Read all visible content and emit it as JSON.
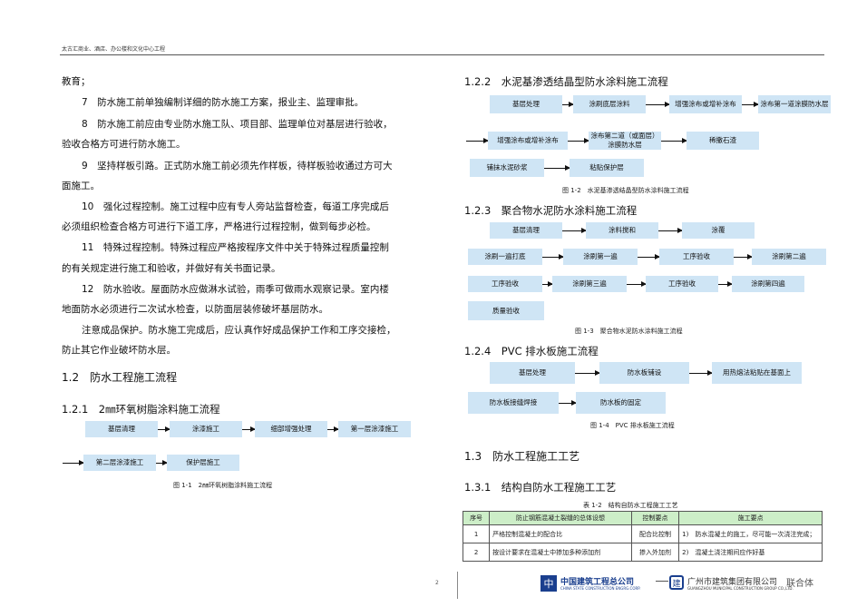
{
  "header": {
    "text": "太古汇商业、酒店、办公楼和文化中心工程"
  },
  "left": {
    "paragraphs": [
      "教育；",
      "7　防水施工前单独编制详细的防水施工方案，报业主、监理审批。",
      "8　防水施工前应由专业防水施工队、项目部、监理单位对基层进行验收，",
      "验收合格方可进行防水施工。",
      "9　坚持样板引路。正式防水施工前必须先作样板，待样板验收通过方可大",
      "面施工。",
      "10　强化过程控制。施工过程中应有专人旁站监督检查，每道工序完成后",
      "必须组织检查合格方可进行下道工序，严格进行过程控制，做到每步必检。",
      "11　特殊过程控制。特殊过程应严格按程序文件中关于特殊过程质量控制",
      "的有关规定进行施工和验收，并做好有关书面记录。",
      "12　防水验收。屋面防水应做淋水试验，雨季可做雨水观察记录。室内楼",
      "地面防水必须进行二次试水检查，以防面层装修破坏基层防水。",
      "注意成品保护。防水施工完成后，应认真作好成品保护工作和工序交接检，",
      "防止其它作业破坏防水层。"
    ],
    "section_1_2": "1.2　防水工程施工流程",
    "section_1_2_1": "1.2.1　2㎜环氧树脂涂料施工流程",
    "flow1": [
      "基层清理",
      "涂漆施工",
      "细部增强处理",
      "第一层涂漆施工",
      "第二层涂漆施工",
      "保护层施工"
    ],
    "caption1": "图 1-1　2㎜环氧树脂涂料施工流程"
  },
  "right": {
    "section_1_2_2": "1.2.2　水泥基渗透结晶型防水涂料施工流程",
    "flow2": [
      "基层处理",
      "涂刷底层涂料",
      "增强涂布或增补涂布",
      "涂布第一道涂膜防水层",
      "增强涂布或增补涂布",
      "涂布第二道（或面层）涂膜防水层",
      "稀撒石渣",
      "铺抹水泥砂浆",
      "粘贴保护层"
    ],
    "caption2": "图 1-2　水泥基渗透结晶型防水涂料施工流程",
    "section_1_2_3": "1.2.3　聚合物水泥防水涂料施工流程",
    "flow3": [
      "基层清理",
      "涂料搅和",
      "涂覆",
      "涂刷一遍打底",
      "涂刷第一遍",
      "工序验收",
      "涂刷第二遍",
      "工序验收",
      "涂刷第三遍",
      "工序验收",
      "涂刷第四遍",
      "质量验收"
    ],
    "caption3": "图 1-3　聚合物水泥防水涂料施工流程",
    "section_1_2_4": "1.2.4　PVC 排水板施工流程",
    "flow4": [
      "基层处理",
      "防水板铺设",
      "用热熔法粘贴在基面上",
      "防水板接缝焊接",
      "防水板的固定"
    ],
    "caption4": "图 1-4　PVC 排水板施工流程",
    "section_1_3": "1.3　防水工程施工工艺",
    "section_1_3_1": "1.3.1　结构自防水工程施工工艺",
    "table_caption": "表 1-2　结构自防水工程施工工艺",
    "table": {
      "headers": [
        "序号",
        "防止钢筋混凝土裂缝的总体设想",
        "控制要点",
        "施工要点"
      ],
      "rows": [
        [
          "1",
          "严格控制混凝土的配合比",
          "配合比控制",
          "1)　防水混凝土的施工，尽可能一次浇注完成；"
        ],
        [
          "2",
          "按设计要求在混凝土中掺加多种添加剂",
          "掺入外加剂",
          "2)　混凝土浇注期间应作好基"
        ]
      ]
    }
  },
  "footer": {
    "page": "2",
    "logo1": "中国建筑工程总公司",
    "logo1_en": "CHINA STATE CONSTRUCTION ENGRG.CORP.",
    "logo2": "广州市建筑集团有限公司",
    "logo2_en": "GUANGZHOU MUNICIPAL CONSTRUCTION GROUP CO.,LTD.",
    "joint": "联合体"
  }
}
